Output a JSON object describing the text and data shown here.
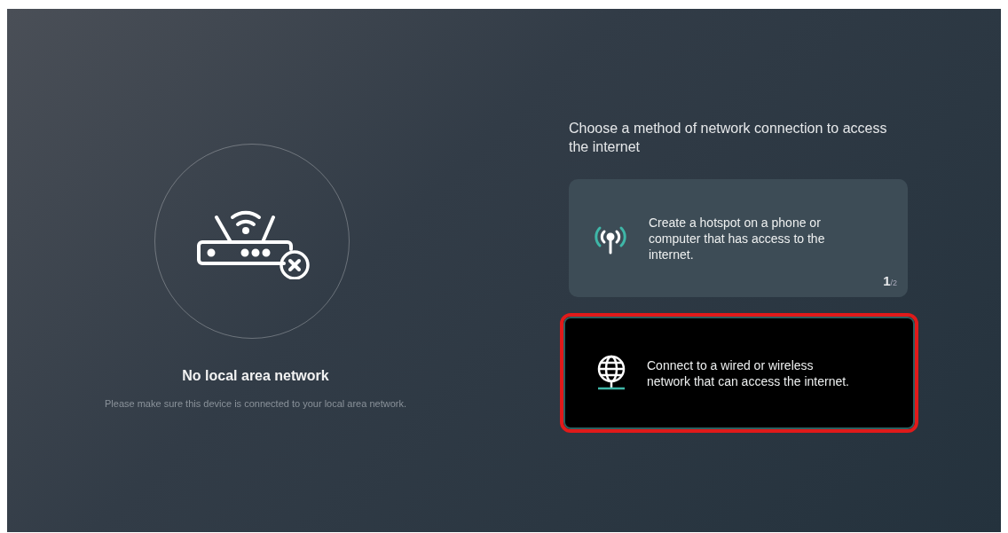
{
  "status": {
    "title": "No local area network",
    "message": "Please make sure this device is connected to your local area network."
  },
  "prompt": "Choose a method of network connection to access the internet",
  "options": [
    {
      "kind": "hotspot",
      "text": "Create a hotspot on a phone or computer that has access to the internet.",
      "selected": false,
      "counter": {
        "current": "1",
        "total": "/2"
      }
    },
    {
      "kind": "network",
      "text": "Connect to a wired or wireless network that can access the internet.",
      "selected": true
    }
  ]
}
